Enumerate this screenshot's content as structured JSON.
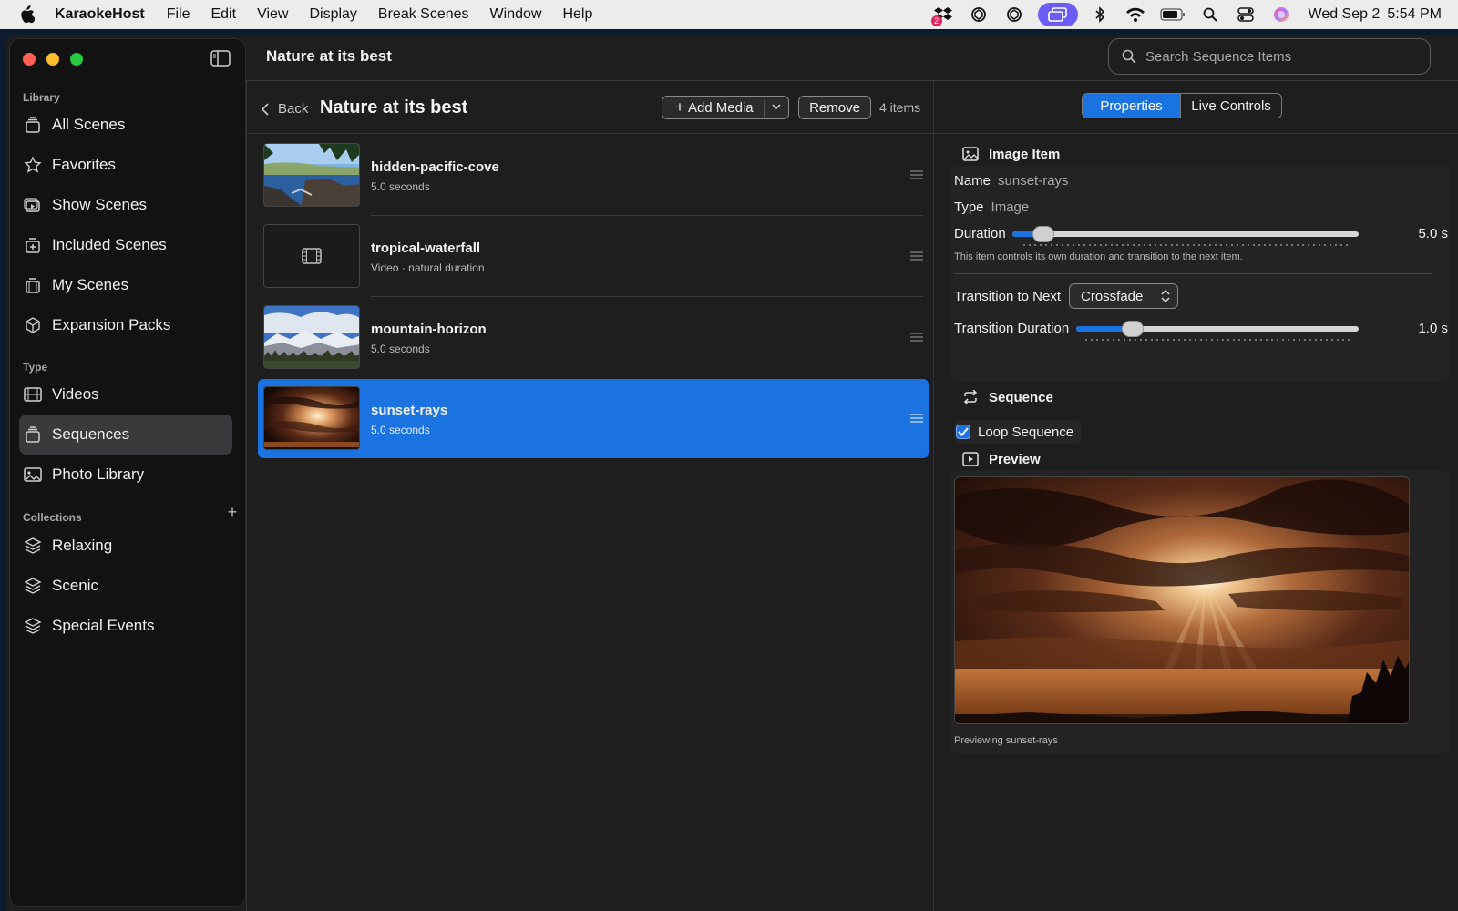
{
  "menubar": {
    "app_name": "KaraokeHost",
    "menus": [
      "File",
      "Edit",
      "View",
      "Display",
      "Break Scenes",
      "Window",
      "Help"
    ],
    "clock_day": "Wed Sep 2",
    "clock_time": "5:54 PM",
    "dropbox_badge": "2",
    "status_icons": [
      "dropbox-icon",
      "chatgpt-icon",
      "openai-icon",
      "screen-mirroring-icon",
      "bluetooth-icon",
      "wifi-icon",
      "battery-icon",
      "spotlight-search-icon",
      "control-center-icon",
      "siri-icon"
    ]
  },
  "window": {
    "title": "Nature at its best",
    "search_placeholder": "Search Sequence Items"
  },
  "sidebar": {
    "sections": {
      "library": "Library",
      "type": "Type",
      "collections": "Collections"
    },
    "library_items": [
      {
        "label": "All Scenes",
        "icon": "stack-icon"
      },
      {
        "label": "Favorites",
        "icon": "star-icon"
      },
      {
        "label": "Show Scenes",
        "icon": "play-stack-icon"
      },
      {
        "label": "Included Scenes",
        "icon": "plus-stack-icon"
      },
      {
        "label": "My Scenes",
        "icon": "film-stack-icon"
      },
      {
        "label": "Expansion Packs",
        "icon": "cube-icon"
      }
    ],
    "type_items": [
      {
        "label": "Videos",
        "icon": "film-icon"
      },
      {
        "label": "Sequences",
        "icon": "stack-icon",
        "active": true
      },
      {
        "label": "Photo Library",
        "icon": "photo-icon"
      }
    ],
    "collection_items": [
      {
        "label": "Relaxing",
        "icon": "layers-icon"
      },
      {
        "label": "Scenic",
        "icon": "layers-icon"
      },
      {
        "label": "Special Events",
        "icon": "layers-icon"
      }
    ]
  },
  "list": {
    "back_label": "Back",
    "title": "Nature at its best",
    "add_media_label": "Add Media",
    "remove_label": "Remove",
    "count_label": "4 items",
    "items": [
      {
        "name": "hidden-pacific-cove",
        "sub": "5.0 seconds",
        "thumb": "cove"
      },
      {
        "name": "tropical-waterfall",
        "sub": "Video · natural duration",
        "thumb": "video-placeholder"
      },
      {
        "name": "mountain-horizon",
        "sub": "5.0 seconds",
        "thumb": "mountain"
      },
      {
        "name": "sunset-rays",
        "sub": "5.0 seconds",
        "thumb": "sunset",
        "selected": true
      }
    ]
  },
  "inspector": {
    "tabs": [
      "Properties",
      "Live Controls"
    ],
    "active_tab": "Properties",
    "image_item": {
      "heading": "Image Item",
      "name_label": "Name",
      "name_value": "sunset-rays",
      "type_label": "Type",
      "type_value": "Image",
      "duration_label": "Duration",
      "duration_value": "5.0 s",
      "duration_level": 0.09,
      "help_text": "This item controls its own duration and transition to the next item.",
      "transition_label": "Transition to Next",
      "transition_value": "Crossfade",
      "transition_duration_label": "Transition Duration",
      "transition_duration_value": "1.0 s",
      "transition_duration_level": 0.2
    },
    "sequence": {
      "heading": "Sequence",
      "loop_label": "Loop Sequence",
      "loop_checked": true
    },
    "preview": {
      "heading": "Preview",
      "caption": "Previewing sunset-rays"
    }
  },
  "colors": {
    "accent": "#1a73e0",
    "window_bg": "#1e1e1e",
    "sidebar_bg": "#121212"
  }
}
